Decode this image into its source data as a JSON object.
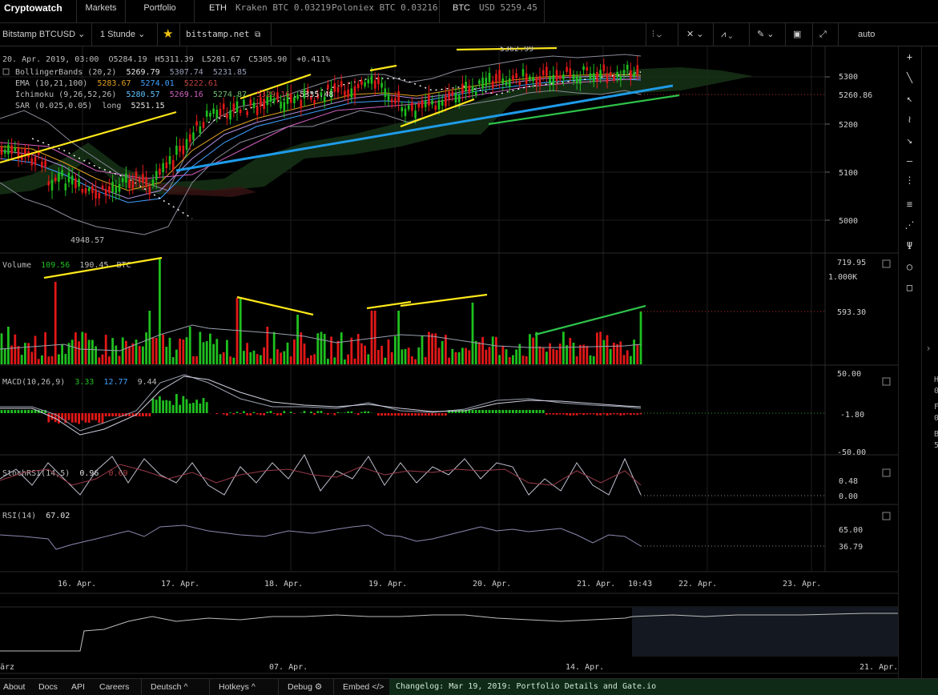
{
  "topbar": {
    "brand": "Cryptowatch",
    "markets": "Markets",
    "portfolio": "Portfolio",
    "eth_label": "ETH",
    "eth_kraken": "Kraken BTC 0.03219",
    "eth_poloniex": "Poloniex BTC 0.03216",
    "btc_label": "BTC",
    "btc_usd": "USD 5259.45"
  },
  "toolbar": {
    "market": "Bitstamp BTCUSD",
    "interval": "1 Stunde",
    "exchange_link": "bitstamp.net",
    "scale": "auto"
  },
  "chart": {
    "ohlc": {
      "date": "20. Apr. 2019, 03:00",
      "o": "O5284.19",
      "h": "H5311.39",
      "l": "L5281.67",
      "c": "C5305.90",
      "change": "+0.411%"
    },
    "bb": {
      "label": "BollingerBands (20,2)",
      "v1": "5269.79",
      "v2": "5307.74",
      "v3": "5231.85"
    },
    "ema": {
      "label": "EMA (10,21,100)",
      "v1": "5283.67",
      "v2": "5274.01",
      "v3": "5222.61"
    },
    "ichi": {
      "label": "Ichimoku (9,26,52,26)",
      "v1": "5280.57",
      "v2": "5269.16",
      "v3": "5274.87",
      "v4": "5329.16",
      "v5": "5335.48"
    },
    "sar": {
      "label": "SAR (0.025,0.05)",
      "mode": "long",
      "v1": "5251.15"
    },
    "price_labels": {
      "p5300": "5300",
      "p5200": "5200",
      "p5100": "5100",
      "p5000": "5000",
      "last": "5260.86",
      "low": "4948.57",
      "high": "5362.99"
    },
    "volume": {
      "label": "Volume",
      "v1": "109.56",
      "v2": "190.45",
      "unit": "BTC",
      "max": "719.95",
      "k": "1.000K",
      "last": "593.30"
    },
    "macd": {
      "label": "MACD(10,26,9)",
      "v1": "3.33",
      "v2": "12.77",
      "v3": "9.44",
      "top": "50.00",
      "cur": "-1.80",
      "bottom": "-50.00"
    },
    "stoch": {
      "label": "StochRSI(14,5)",
      "v1": "0.96",
      "v2": "0.69",
      "a": "0.48",
      "b": "0.00"
    },
    "rsi": {
      "label": "RSI(14)",
      "v1": "67.02",
      "a": "65.00",
      "b": "36.79"
    },
    "dates": [
      "16. Apr.",
      "17. Apr.",
      "18. Apr.",
      "19. Apr.",
      "20. Apr.",
      "21. Apr.",
      "22. Apr.",
      "23. Apr."
    ],
    "current_time": "10:43",
    "overview_dates": [
      "ärz",
      "07. Apr.",
      "14. Apr.",
      "21. Apr."
    ],
    "colors": {
      "up": "#1fbf1f",
      "down": "#e01818",
      "annotation_yellow": "#ffe81a",
      "annotation_blue": "#1e9be8",
      "annotation_green": "#2ec24a",
      "cloud": "#1a3a1a"
    }
  },
  "right_panel_clip": [
    "H",
    "0",
    "F",
    "0",
    "B",
    "5"
  ],
  "bottombar": {
    "about": "About",
    "docs": "Docs",
    "api": "API",
    "careers": "Careers",
    "language": "Deutsch",
    "hotkeys": "Hotkeys",
    "debug": "Debug",
    "embed": "Embed",
    "changelog": "Changelog: Mar 19, 2019: Portfolio Details and Gate.io"
  }
}
